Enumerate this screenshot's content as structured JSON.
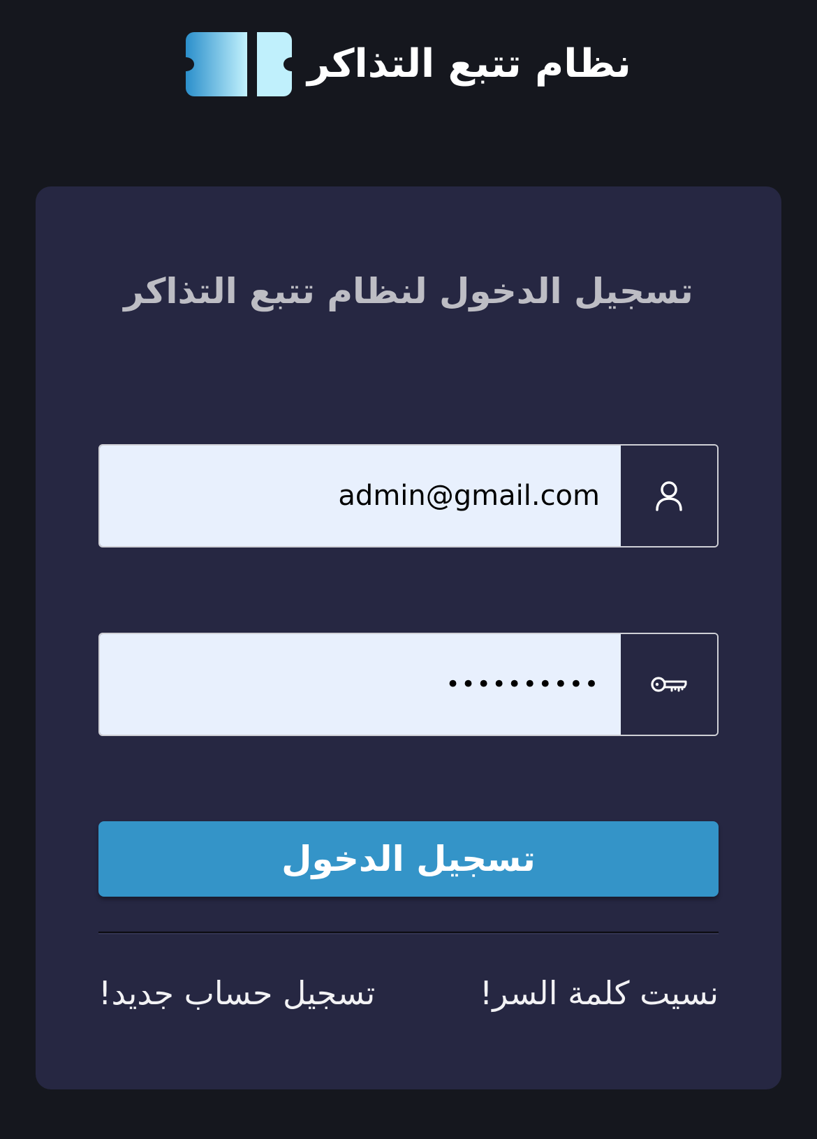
{
  "header": {
    "title": "نظام تتبع التذاكر",
    "logo_icon": "ticket-icon"
  },
  "login_card": {
    "title": "تسجيل الدخول لنظام تتبع التذاكر",
    "email": {
      "value": "admin@gmail.com",
      "icon": "user-icon"
    },
    "password": {
      "value": "••••••••••",
      "icon": "key-icon"
    },
    "submit_label": "تسجيل الدخول",
    "forgot_password_link": "نسيت كلمة السر!",
    "register_link": "تسجيل حساب جديد!"
  },
  "colors": {
    "page_background": "#15171e",
    "card_background": "#262742",
    "accent": "#3494c8",
    "input_background": "#e8f0fd"
  }
}
